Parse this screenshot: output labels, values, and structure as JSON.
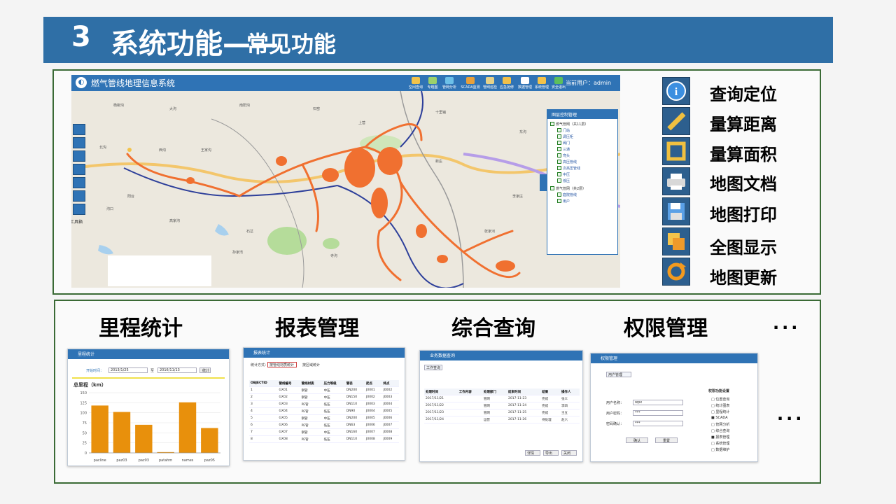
{
  "header": {
    "num": "3",
    "title": "系统功能——",
    "subtitle": "常见功能"
  },
  "gis": {
    "title": "燃气管线地理信息系统",
    "user": "当前用户：admin",
    "toolbar": [
      "空间查询",
      "专题图",
      "管网分析",
      "SCADA监测",
      "管网巡检",
      "应急抢修",
      "数据管理",
      "系统管理",
      "安全退出"
    ],
    "left_tool_label": "工具箱",
    "map_labels": [
      "杨柳沟",
      "大沟",
      "南阳沟",
      "石窑",
      "北沟",
      "西沟",
      "上营",
      "王家沟",
      "东沟",
      "新庄",
      "阳台",
      "高家沟",
      "孙家湾",
      "张家河",
      "十里铺",
      "李家庄",
      "石岔",
      "寺沟",
      "沟口"
    ],
    "layers": {
      "title": "图层控制管理",
      "group1": "燃气管网（共11层）",
      "items1": [
        "门站",
        "调压柜",
        "阀门",
        "三通",
        "弯头",
        "高压管线",
        "次高压管线",
        "中压",
        "低压"
      ],
      "group2": "燃气管网（共2层）",
      "items2": [
        "庭院管线",
        "用户"
      ]
    }
  },
  "right_tools": [
    "查询定位",
    "量算距离",
    "量算面积",
    "地图文档",
    "地图打印",
    "全图显示",
    "地图更新"
  ],
  "sections": [
    "里程统计",
    "报表管理",
    "综合查询",
    "权限管理"
  ],
  "ellipsis": "...",
  "thumbs": {
    "mileage": {
      "title": "里程统计",
      "from_label": "开始时间：",
      "from": "2013/1/25",
      "to_label": "至",
      "to": "2016/11/13",
      "btn": "统计",
      "chart_title": "总里程（km）"
    },
    "report": {
      "title": "报表统计",
      "opt1": "统计方式：",
      "opt1_val": "按管线材质统计",
      "opt2": "按区域统计",
      "columns": [
        "OBJECTID",
        "管线编号",
        "管线材质",
        "压力等级",
        "管径",
        "起点",
        "终点"
      ],
      "rows": [
        [
          "1",
          "GX01",
          "钢管",
          "中压",
          "DN200",
          "J0001",
          "J0002"
        ],
        [
          "2",
          "GX02",
          "钢管",
          "中压",
          "DN150",
          "J0002",
          "J0003"
        ],
        [
          "3",
          "GX03",
          "PE管",
          "低压",
          "DN110",
          "J0003",
          "J0004"
        ],
        [
          "4",
          "GX04",
          "PE管",
          "低压",
          "DN90",
          "J0004",
          "J0005"
        ],
        [
          "5",
          "GX05",
          "钢管",
          "中压",
          "DN200",
          "J0005",
          "J0006"
        ],
        [
          "6",
          "GX06",
          "PE管",
          "低压",
          "DN63",
          "J0006",
          "J0007"
        ],
        [
          "7",
          "GX07",
          "钢管",
          "中压",
          "DN160",
          "J0007",
          "J0008"
        ],
        [
          "8",
          "GX08",
          "PE管",
          "低压",
          "DN110",
          "J0008",
          "J0009"
        ]
      ]
    },
    "query": {
      "title": "业务数据查询",
      "tab": "工作查询",
      "columns": [
        "处理时间",
        "工作内容",
        "处理部门",
        "结束时间",
        "结果",
        "操作人"
      ],
      "rows": [
        [
          "2017/11/21",
          "",
          "管网",
          "2017-11-23",
          "完成",
          "张三"
        ],
        [
          "2017/11/22",
          "",
          "管网",
          "2017-11-24",
          "完成",
          "李四"
        ],
        [
          "2017/11/23",
          "",
          "管网",
          "2017-11-25",
          "完成",
          "王五"
        ],
        [
          "2017/11/24",
          "",
          "运营",
          "2017-11-26",
          "待处理",
          "赵六"
        ]
      ],
      "buttons": [
        "详情",
        "导出",
        "关闭"
      ]
    },
    "permission": {
      "title": "权限管理",
      "tab": "用户管理",
      "f1": "用户名称：",
      "v1": "wpx",
      "f2": "用户密码：",
      "v2": "***",
      "f3": "密码确认：",
      "v3": "***",
      "btn1": "确认",
      "btn2": "重置",
      "perm_title": "权限功能设置",
      "perms": [
        "位置查询",
        "统计图表",
        "里程统计",
        "SCADA",
        "管网分析",
        "综合查询",
        "报表管理",
        "系统管理",
        "数据维护"
      ]
    }
  },
  "chart_data": {
    "type": "bar",
    "title": "总里程（km）",
    "categories": [
      "pacline",
      "paz03",
      "paz03",
      "patahm",
      "names",
      "paz05"
    ],
    "values": [
      118,
      102,
      70,
      2,
      126,
      62
    ],
    "ylim": [
      0,
      150
    ],
    "yticks": [
      0,
      25,
      50,
      75,
      100,
      125,
      150
    ],
    "color": "#e8900c"
  },
  "colors": {
    "banner": "#2f6fa6",
    "frame": "#3a6a35",
    "app_blue": "#2f73b5",
    "pipe_orange": "#f07030"
  }
}
